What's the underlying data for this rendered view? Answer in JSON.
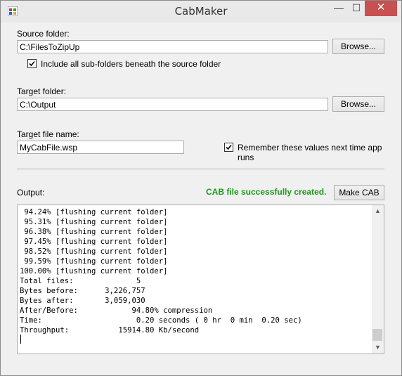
{
  "window": {
    "title": "CabMaker",
    "minimize_glyph": "—",
    "maximize_glyph": "☐",
    "close_glyph": "✕",
    "icon": "app-icon"
  },
  "source": {
    "label": "Source folder:",
    "value": "C:\\FilesToZipUp",
    "browse_label": "Browse...",
    "include_subfolders_label": "Include all sub-folders beneath the source folder",
    "include_subfolders_checked": true
  },
  "target": {
    "label": "Target folder:",
    "value": "C:\\Output",
    "browse_label": "Browse..."
  },
  "target_file": {
    "label": "Target file name:",
    "value": "MyCabFile.wsp"
  },
  "remember": {
    "label": "Remember these values next time app runs",
    "checked": true
  },
  "output": {
    "label": "Output:",
    "status": "CAB file successfully created.",
    "status_color": "#1a9a1a",
    "make_cab_label": "Make CAB",
    "lines": [
      " 94.24% [flushing current folder]",
      " 95.31% [flushing current folder]",
      " 96.38% [flushing current folder]",
      " 97.45% [flushing current folder]",
      " 98.52% [flushing current folder]",
      " 99.59% [flushing current folder]",
      "100.00% [flushing current folder]",
      "Total files:              5",
      "Bytes before:      3,226,757",
      "Bytes after:       3,059,030",
      "After/Before:            94.80% compression",
      "Time:                     0.20 seconds ( 0 hr  0 min  0.20 sec)",
      "Throughput:           15914.80 Kb/second"
    ]
  }
}
